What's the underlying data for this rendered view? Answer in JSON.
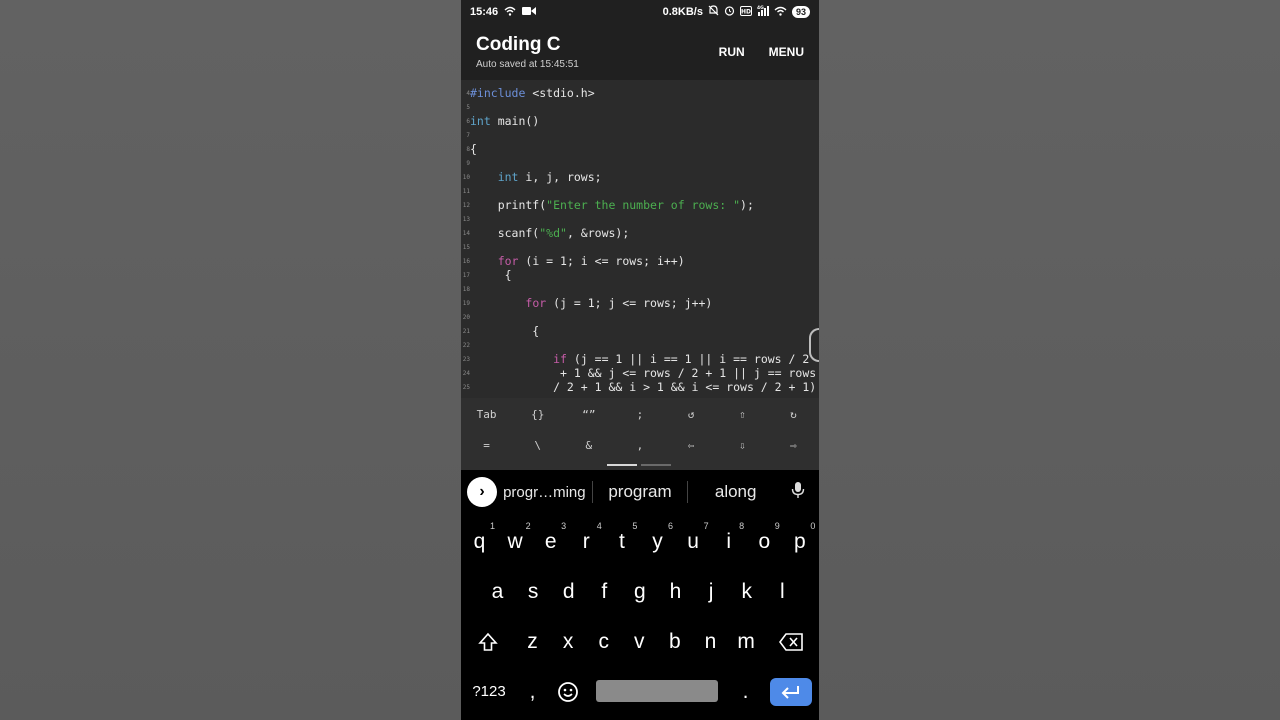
{
  "status_bar": {
    "time": "15:46",
    "speed": "0.8KB/s",
    "battery": "93",
    "icons": [
      "wifi-icon",
      "video-icon",
      "mute-icon",
      "alarm-icon",
      "volte-icon",
      "signal-4g-icon",
      "wifi-icon",
      "battery-icon"
    ]
  },
  "appbar": {
    "title": "Coding C",
    "subtitle": "Auto saved at 15:45:51",
    "run_label": "RUN",
    "menu_label": "MENU"
  },
  "editor": {
    "lines": [
      {
        "num": "4",
        "text": "#include <stdio.h>"
      },
      {
        "num": "5",
        "text": ""
      },
      {
        "num": "6",
        "text": "int main()"
      },
      {
        "num": "7",
        "text": ""
      },
      {
        "num": "8",
        "text": "{"
      },
      {
        "num": "9",
        "text": ""
      },
      {
        "num": "10",
        "text": "    int i, j, rows;"
      },
      {
        "num": "11",
        "text": ""
      },
      {
        "num": "12",
        "text": "    printf(\"Enter the number of rows: \");"
      },
      {
        "num": "13",
        "text": ""
      },
      {
        "num": "14",
        "text": "    scanf(\"%d\", &rows);"
      },
      {
        "num": "15",
        "text": ""
      },
      {
        "num": "16",
        "text": "    for (i = 1; i <= rows; i++)"
      },
      {
        "num": "17",
        "text": "     {"
      },
      {
        "num": "18",
        "text": ""
      },
      {
        "num": "19",
        "text": "        for (j = 1; j <= rows; j++)"
      },
      {
        "num": "20",
        "text": ""
      },
      {
        "num": "21",
        "text": "         {"
      },
      {
        "num": "22",
        "text": ""
      },
      {
        "num": "23",
        "text": "            if (j == 1 || i == 1 || i == rows / 2"
      },
      {
        "num": "24",
        "text": "             + 1 && j <= rows / 2 + 1 || j == rows"
      },
      {
        "num": "25",
        "text": "            / 2 + 1 && i > 1 && i <= rows / 2 + 1)"
      }
    ]
  },
  "symbol_bar": {
    "row1": [
      "Tab",
      "{}",
      "“”",
      ";",
      "↺",
      "⇧",
      "↻"
    ],
    "row2": [
      "=",
      "\\",
      "&",
      ",",
      "⇦",
      "⇩",
      "⇨"
    ]
  },
  "keyboard": {
    "suggestions": [
      "progr…ming",
      "program",
      "along"
    ],
    "row1": [
      {
        "k": "q",
        "n": "1"
      },
      {
        "k": "w",
        "n": "2"
      },
      {
        "k": "e",
        "n": "3"
      },
      {
        "k": "r",
        "n": "4"
      },
      {
        "k": "t",
        "n": "5"
      },
      {
        "k": "y",
        "n": "6"
      },
      {
        "k": "u",
        "n": "7"
      },
      {
        "k": "i",
        "n": "8"
      },
      {
        "k": "o",
        "n": "9"
      },
      {
        "k": "p",
        "n": "0"
      }
    ],
    "row2": [
      "a",
      "s",
      "d",
      "f",
      "g",
      "h",
      "j",
      "k",
      "l"
    ],
    "row3": [
      "z",
      "x",
      "c",
      "v",
      "b",
      "n",
      "m"
    ],
    "sym_label": "?123",
    "comma": ",",
    "period": "."
  }
}
